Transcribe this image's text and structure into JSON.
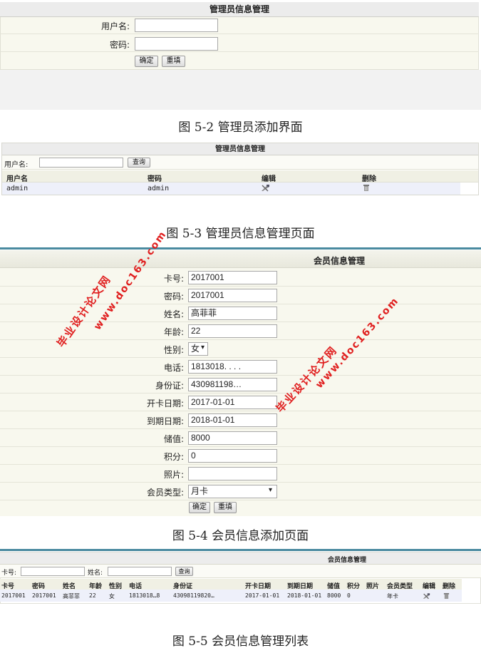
{
  "fig1": {
    "header": "管理员信息管理",
    "username_label": "用户名:",
    "password_label": "密码:",
    "confirm_label": "确定",
    "reset_label": "重填",
    "caption": "图 5-2 管理员添加界面"
  },
  "fig2": {
    "header": "管理员信息管理",
    "search_label": "用户名:",
    "search_button": "查询",
    "columns": [
      "用户名",
      "密码",
      "编辑",
      "删除"
    ],
    "row": {
      "username": "admin",
      "password": "admin",
      "edit_icon": "edit-icon",
      "delete_icon": "trash-icon"
    },
    "caption": "图 5-3 管理员信息管理页面"
  },
  "fig3": {
    "header": "会员信息管理",
    "fields": [
      {
        "label": "卡号:",
        "value": "2017001"
      },
      {
        "label": "密码:",
        "value": "2017001"
      },
      {
        "label": "姓名:",
        "value": "高菲菲"
      },
      {
        "label": "年龄:",
        "value": "22"
      },
      {
        "label": "性别:",
        "value": "女"
      },
      {
        "label": "电话:",
        "value": "1813018. . . ."
      },
      {
        "label": "身份证:",
        "value": "430981198…"
      },
      {
        "label": "开卡日期:",
        "value": "2017-01-01"
      },
      {
        "label": "到期日期:",
        "value": "2018-01-01"
      },
      {
        "label": "储值:",
        "value": "8000"
      },
      {
        "label": "积分:",
        "value": "0"
      },
      {
        "label": "照片:",
        "value": ""
      },
      {
        "label": "会员类型:",
        "value": "月卡"
      }
    ],
    "confirm_label": "确定",
    "reset_label": "重填",
    "caption": "图 5-4 会员信息添加页面"
  },
  "fig4": {
    "header": "会员信息管理",
    "search_card_label": "卡号:",
    "search_name_label": "姓名:",
    "search_button": "查询",
    "columns": [
      "卡号",
      "密码",
      "姓名",
      "年龄",
      "性别",
      "电话",
      "身份证",
      "开卡日期",
      "到期日期",
      "储值",
      "积分",
      "照片",
      "会员类型",
      "编辑",
      "删除"
    ],
    "row": [
      "2017001",
      "2017001",
      "高菲菲",
      "22",
      "女",
      "1813018…8",
      "43098119820…",
      "2017-01-01",
      "2018-01-01",
      "8000",
      "0",
      "",
      "年卡"
    ],
    "caption": "图 5-5 会员信息管理列表"
  },
  "watermark": {
    "line1": "毕业设计论文网",
    "line2": "www.doc163.com"
  },
  "colors": {
    "accent_teal": "#4a8aa0",
    "watermark_red": "#e02020",
    "panel_cream": "#f8f8ee",
    "header_gray": "#ececec"
  }
}
